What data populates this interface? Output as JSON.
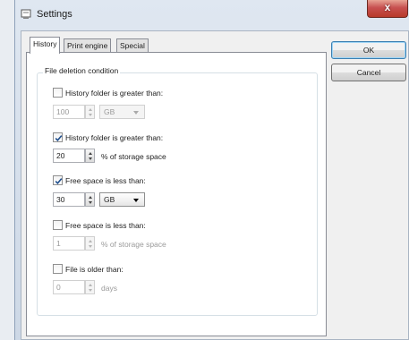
{
  "window": {
    "title": "Settings",
    "close_glyph": "x",
    "icon": "settings-window-icon"
  },
  "tabs": [
    {
      "label": "History",
      "active": true
    },
    {
      "label": "Print engine",
      "active": false
    },
    {
      "label": "Special",
      "active": false
    }
  ],
  "group": {
    "legend": "File deletion condition"
  },
  "conditions": [
    {
      "checked": false,
      "label": "History folder is greater than:",
      "value": "100",
      "unit_select": "GB",
      "enabled": false
    },
    {
      "checked": true,
      "label": "History folder is greater than:",
      "value": "20",
      "suffix": "% of storage space",
      "enabled": true
    },
    {
      "checked": true,
      "label": "Free space is less than:",
      "value": "30",
      "unit_select": "GB",
      "enabled": true
    },
    {
      "checked": false,
      "label": "Free space is less than:",
      "value": "1",
      "suffix": "% of storage space",
      "enabled": false
    },
    {
      "checked": false,
      "label": "File is older than:",
      "value": "0",
      "suffix": "days",
      "enabled": false
    }
  ],
  "buttons": {
    "ok": "OK",
    "cancel": "Cancel"
  },
  "colors": {
    "check": "#1f4e8c",
    "close_button": "#c75050",
    "default_button_border": "#3c7fb1"
  }
}
